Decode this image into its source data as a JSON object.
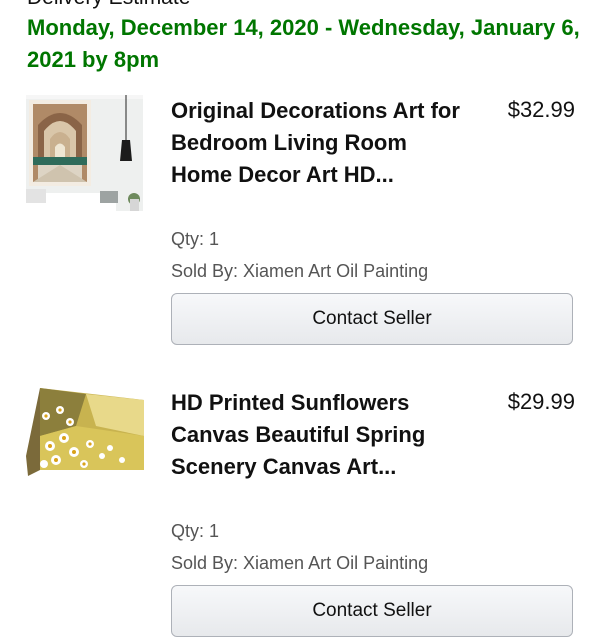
{
  "delivery": {
    "label": "Delivery Estimate",
    "dates": "Monday, December 14, 2020 - Wednesday, January 6, 2021 by 8pm"
  },
  "items": [
    {
      "title": "Original Decorations Art for Bedroom Living Room Home Decor Art HD...",
      "price": "$32.99",
      "qty": "Qty: 1",
      "sold_by": "Sold By: Xiamen Art Oil Painting",
      "contact_label": "Contact Seller",
      "thumb_icon": "arch-corridor-painting-icon"
    },
    {
      "title": "HD Printed Sunflowers Canvas Beautiful Spring Scenery Canvas Art...",
      "price": "$29.99",
      "qty": "Qty: 1",
      "sold_by": "Sold By: Xiamen Art Oil Painting",
      "contact_label": "Contact Seller",
      "thumb_icon": "daisy-field-canvas-icon"
    }
  ],
  "colors": {
    "delivery_green": "#007600",
    "button_border": "#adb1b8"
  }
}
